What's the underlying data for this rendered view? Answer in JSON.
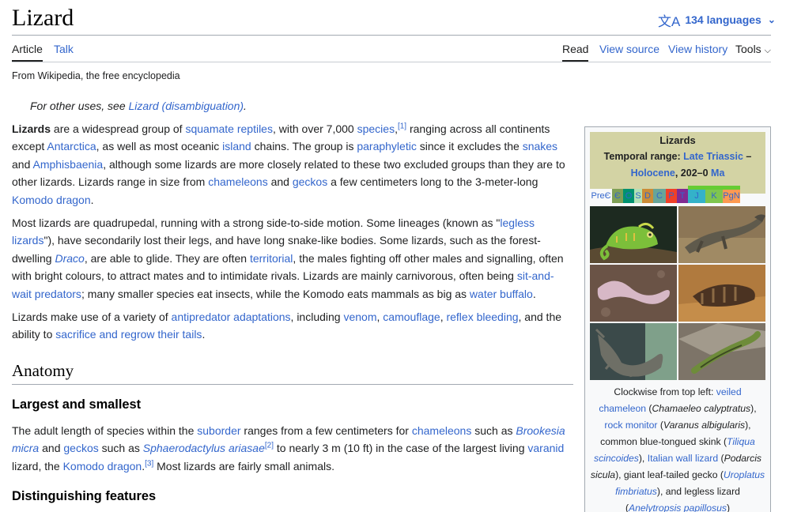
{
  "page": {
    "title": "Lizard",
    "languages_label": "134 languages",
    "tagline": "From Wikipedia, the free encyclopedia",
    "hatnote_prefix": "For other uses, see ",
    "hatnote_link": "Lizard (disambiguation)",
    "hatnote_suffix": "."
  },
  "tabs": {
    "article": "Article",
    "talk": "Talk",
    "read": "Read",
    "view_source": "View source",
    "view_history": "View history",
    "tools": "Tools"
  },
  "paragraphs": {
    "p1": [
      {
        "b": "Lizards"
      },
      {
        "t": " are a widespread group of "
      },
      {
        "a": "squamate reptiles"
      },
      {
        "t": ", with over 7,000 "
      },
      {
        "a": "species"
      },
      {
        "t": ","
      },
      {
        "sup": "[1]"
      },
      {
        "t": " ranging across all continents except "
      },
      {
        "a": "Antarctica"
      },
      {
        "t": ", as well as most oceanic "
      },
      {
        "a": "island"
      },
      {
        "t": " chains. The group is "
      },
      {
        "a": "paraphyletic"
      },
      {
        "t": " since it excludes the "
      },
      {
        "a": "snakes"
      },
      {
        "t": " and "
      },
      {
        "a": "Amphisbaenia"
      },
      {
        "t": ", although some lizards are more closely related to these two excluded groups than they are to other lizards. Lizards range in size from "
      },
      {
        "a": "chameleons"
      },
      {
        "t": " and "
      },
      {
        "a": "geckos"
      },
      {
        "t": " a few centimeters long to the 3-meter-long "
      },
      {
        "a": "Komodo dragon"
      },
      {
        "t": "."
      }
    ],
    "p2": [
      {
        "t": "Most lizards are quadrupedal, running with a strong side-to-side motion. Some lineages (known as \""
      },
      {
        "a": "legless lizards"
      },
      {
        "t": "\"), have secondarily lost their legs, and have long snake-like bodies. Some lizards, such as the forest-dwelling "
      },
      {
        "ai": "Draco"
      },
      {
        "t": ", are able to glide. They are often "
      },
      {
        "a": "territorial"
      },
      {
        "t": ", the males fighting off other males and signalling, often with bright colours, to attract mates and to intimidate rivals. Lizards are mainly carnivorous, often being "
      },
      {
        "a": "sit-and-wait predators"
      },
      {
        "t": "; many smaller species eat insects, while the Komodo eats mammals as big as "
      },
      {
        "a": "water buffalo"
      },
      {
        "t": "."
      }
    ],
    "p3": [
      {
        "t": "Lizards make use of a variety of "
      },
      {
        "a": "antipredator adaptations"
      },
      {
        "t": ", including "
      },
      {
        "a": "venom"
      },
      {
        "t": ", "
      },
      {
        "a": "camouflage"
      },
      {
        "t": ", "
      },
      {
        "a": "reflex bleeding"
      },
      {
        "t": ", and the ability to "
      },
      {
        "a": "sacrifice and regrow their tails"
      },
      {
        "t": "."
      }
    ],
    "p4": [
      {
        "t": "The adult length of species within the "
      },
      {
        "a": "suborder"
      },
      {
        "t": " ranges from a few centimeters for "
      },
      {
        "a": "chameleons"
      },
      {
        "t": " such as "
      },
      {
        "ai": "Brookesia micra"
      },
      {
        "t": " and "
      },
      {
        "a": "geckos"
      },
      {
        "t": " such as "
      },
      {
        "ai": "Sphaerodactylus ariasae"
      },
      {
        "sup": "[2]"
      },
      {
        "t": " to nearly 3 m (10 ft) in the case of the largest living "
      },
      {
        "a": "varanid"
      },
      {
        "t": " lizard, the "
      },
      {
        "a": "Komodo dragon"
      },
      {
        "t": "."
      },
      {
        "sup": "[3]"
      },
      {
        "t": " Most lizards are fairly small animals."
      }
    ]
  },
  "headings": {
    "anatomy": "Anatomy",
    "largest": "Largest and smallest",
    "distinguishing": "Distinguishing features"
  },
  "infobox": {
    "title": "Lizards",
    "temporal_label": "Temporal range:",
    "temporal_link1": "Late Triassic",
    "temporal_dash": " –",
    "temporal_link2": "Holocene",
    "temporal_range": ", 202–0 ",
    "temporal_ma": "Ma",
    "timeline": [
      "PreЄ",
      "Є",
      "O",
      "S",
      "D",
      "C",
      "P",
      "T",
      "J",
      "K",
      "PgN"
    ],
    "timeline_colors": [
      "#f8f9fa",
      "#7fa056",
      "#009270",
      "#b3e1b6",
      "#cb8c37",
      "#67a599",
      "#f04028",
      "#812b92",
      "#34b2c9",
      "#7fc64e",
      "#fd9a52"
    ],
    "photos": [
      "veiled chameleon",
      "rock monitor",
      "blue-tongued skink",
      "Italian wall lizard",
      "leaf-tailed gecko",
      "legless lizard"
    ],
    "caption": [
      {
        "t": "Clockwise from top left: "
      },
      {
        "a": "veiled chameleon"
      },
      {
        "t": " ("
      },
      {
        "i": "Chamaeleo calyptratus"
      },
      {
        "t": "), "
      },
      {
        "a": "rock monitor"
      },
      {
        "t": " ("
      },
      {
        "i": "Varanus albigularis"
      },
      {
        "t": "), common blue-tongued skink ("
      },
      {
        "ai": "Tiliqua scincoides"
      },
      {
        "t": "), "
      },
      {
        "a": "Italian wall lizard"
      },
      {
        "t": " ("
      },
      {
        "i": "Podarcis sicula"
      },
      {
        "t": "), giant leaf-tailed gecko ("
      },
      {
        "ai": "Uroplatus fimbriatus"
      },
      {
        "t": "), and legless lizard ("
      },
      {
        "ai": "Anelytropsis papillosus"
      },
      {
        "t": ")"
      }
    ]
  }
}
